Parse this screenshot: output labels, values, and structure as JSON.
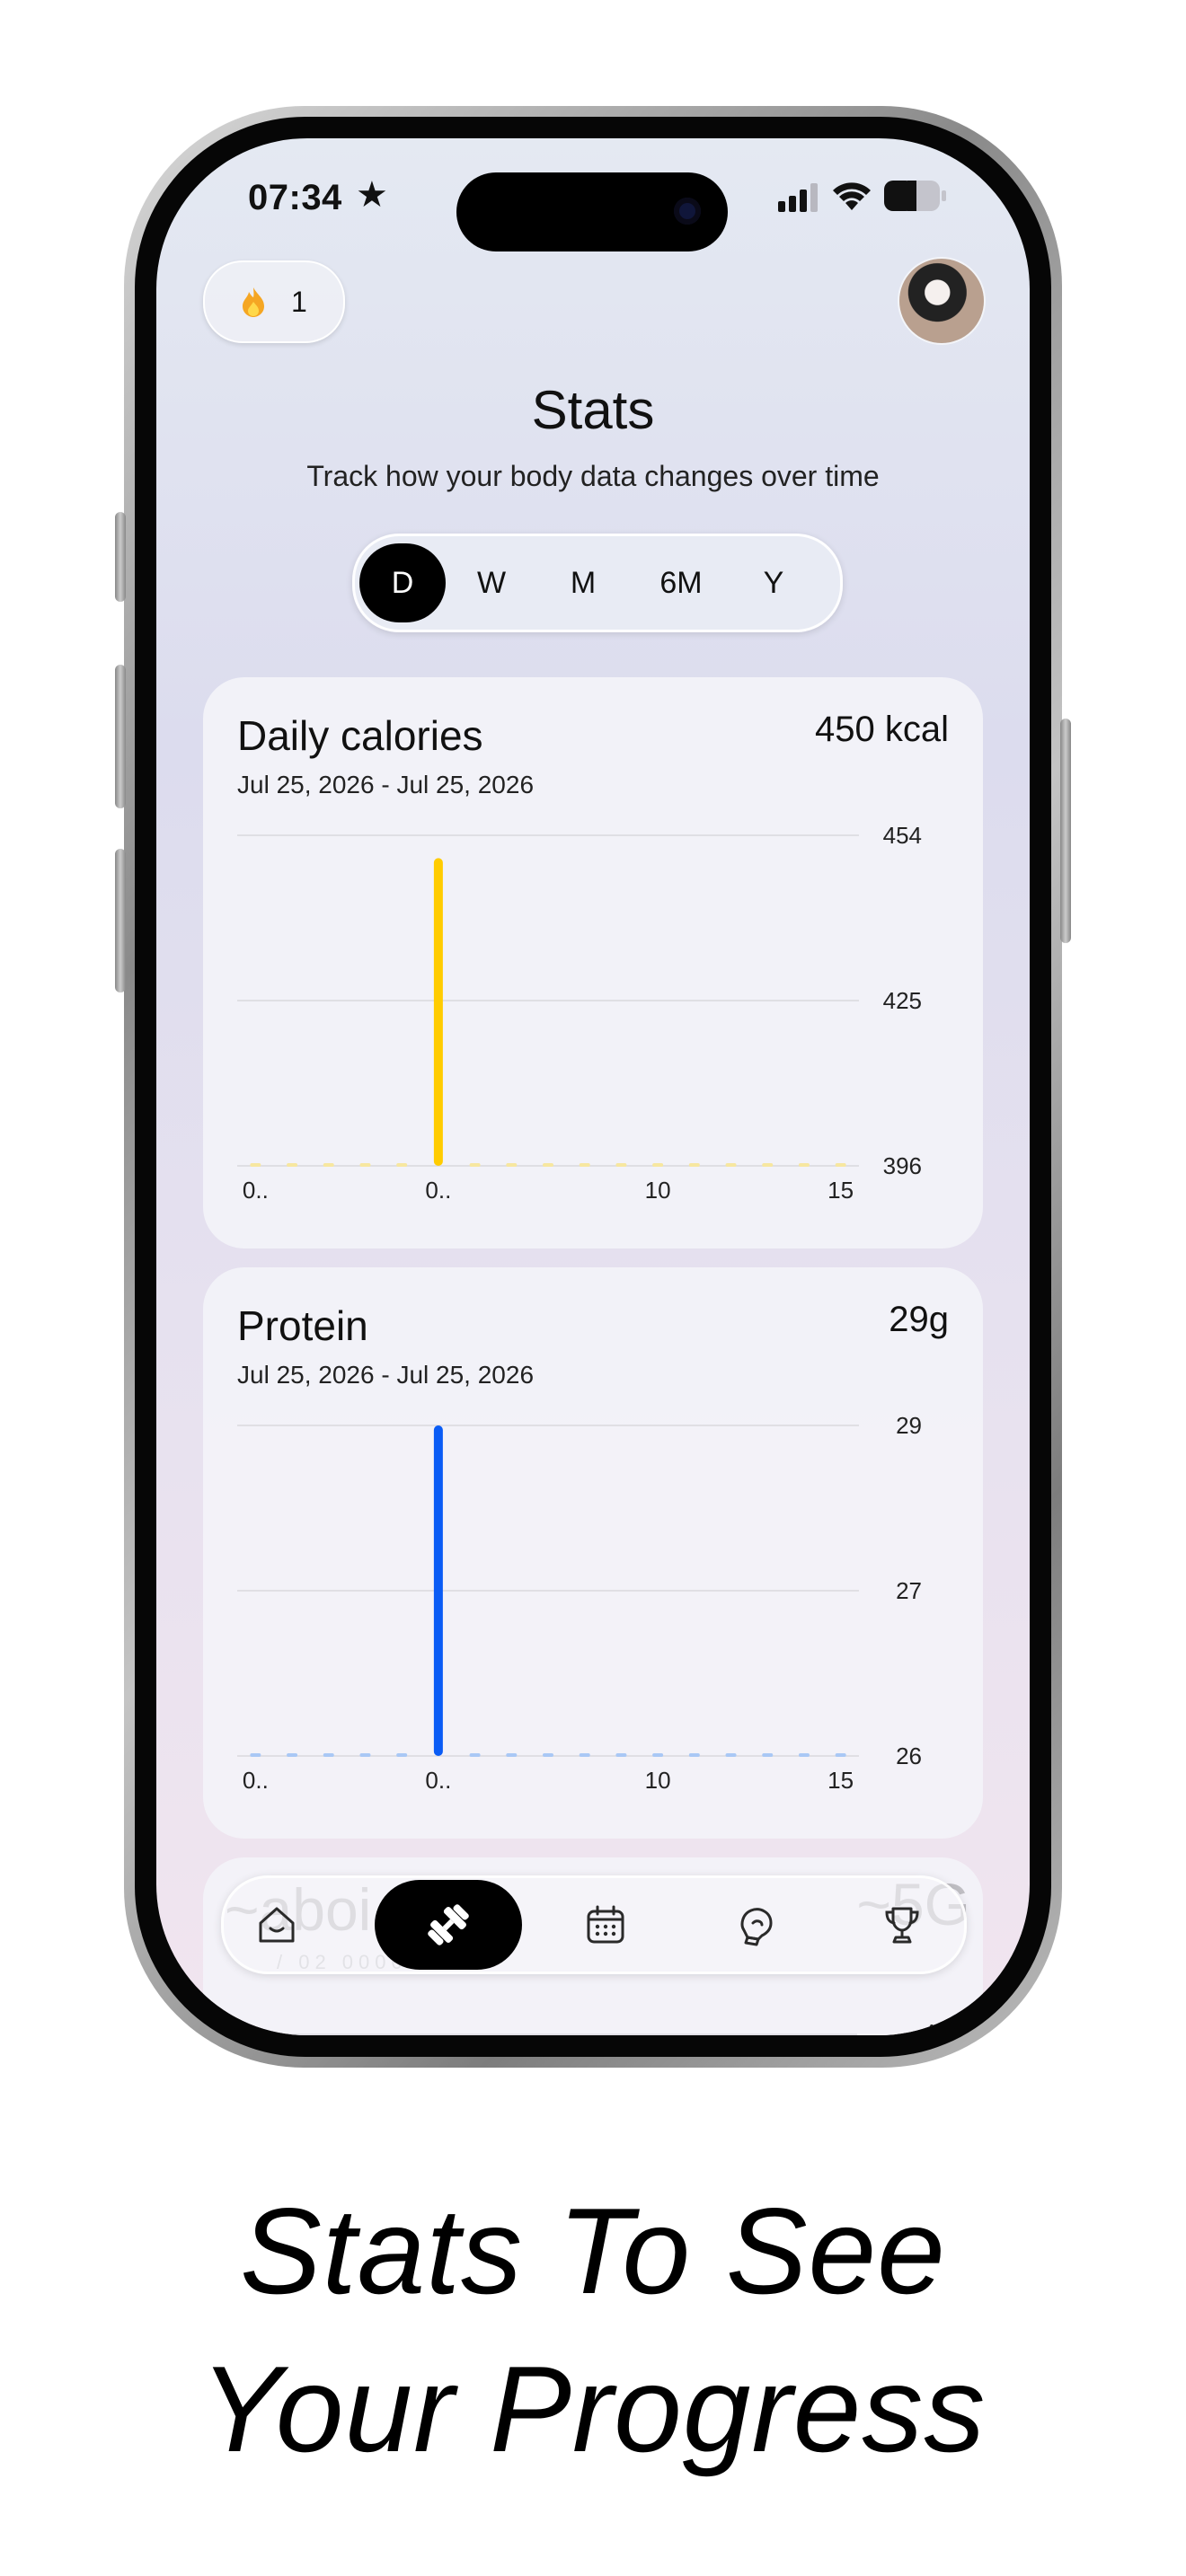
{
  "status_bar": {
    "time": "07:34"
  },
  "header": {
    "streak_count": "1",
    "title": "Stats",
    "subtitle": "Track how your body data changes over time"
  },
  "range_selector": {
    "options": [
      "D",
      "W",
      "M",
      "6M",
      "Y"
    ],
    "selected": "D"
  },
  "cards": [
    {
      "title": "Daily calories",
      "value": "450 kcal",
      "date_range": "Jul 25, 2026 - Jul 25, 2026",
      "bar_color": "#ffcc00",
      "dot_color": "#f7e7a0"
    },
    {
      "title": "Protein",
      "value": "29g",
      "date_range": "Jul 25, 2026 - Jul 25, 2026",
      "bar_color": "#0a5cf5",
      "dot_color": "#a9c8f5"
    }
  ],
  "partial_card": {
    "y_tick": "45",
    "bar_color": "#1aa85a"
  },
  "chart_data": [
    {
      "type": "bar",
      "title": "Daily calories",
      "x_tick_labels": [
        "0..",
        "0..",
        "10",
        "15"
      ],
      "x": [
        5
      ],
      "values": [
        450
      ],
      "ylim": [
        396,
        454
      ],
      "y_tick_labels": [
        "454",
        "425",
        "396"
      ],
      "grid": true
    },
    {
      "type": "bar",
      "title": "Protein",
      "x_tick_labels": [
        "0..",
        "0..",
        "10",
        "15"
      ],
      "x": [
        5
      ],
      "values": [
        29
      ],
      "ylim": [
        26,
        29
      ],
      "y_tick_labels": [
        "29",
        "27",
        "26"
      ],
      "grid": true
    }
  ],
  "tab_bar": {
    "tabs": [
      {
        "icon": "home-icon",
        "active": false
      },
      {
        "icon": "dumbbell-icon",
        "active": true
      },
      {
        "icon": "calendar-icon",
        "active": false
      },
      {
        "icon": "boxing-glove-icon",
        "active": false
      },
      {
        "icon": "trophy-icon",
        "active": false
      }
    ]
  },
  "caption": {
    "line1": "Stats To See",
    "line2": "Your Progress"
  }
}
